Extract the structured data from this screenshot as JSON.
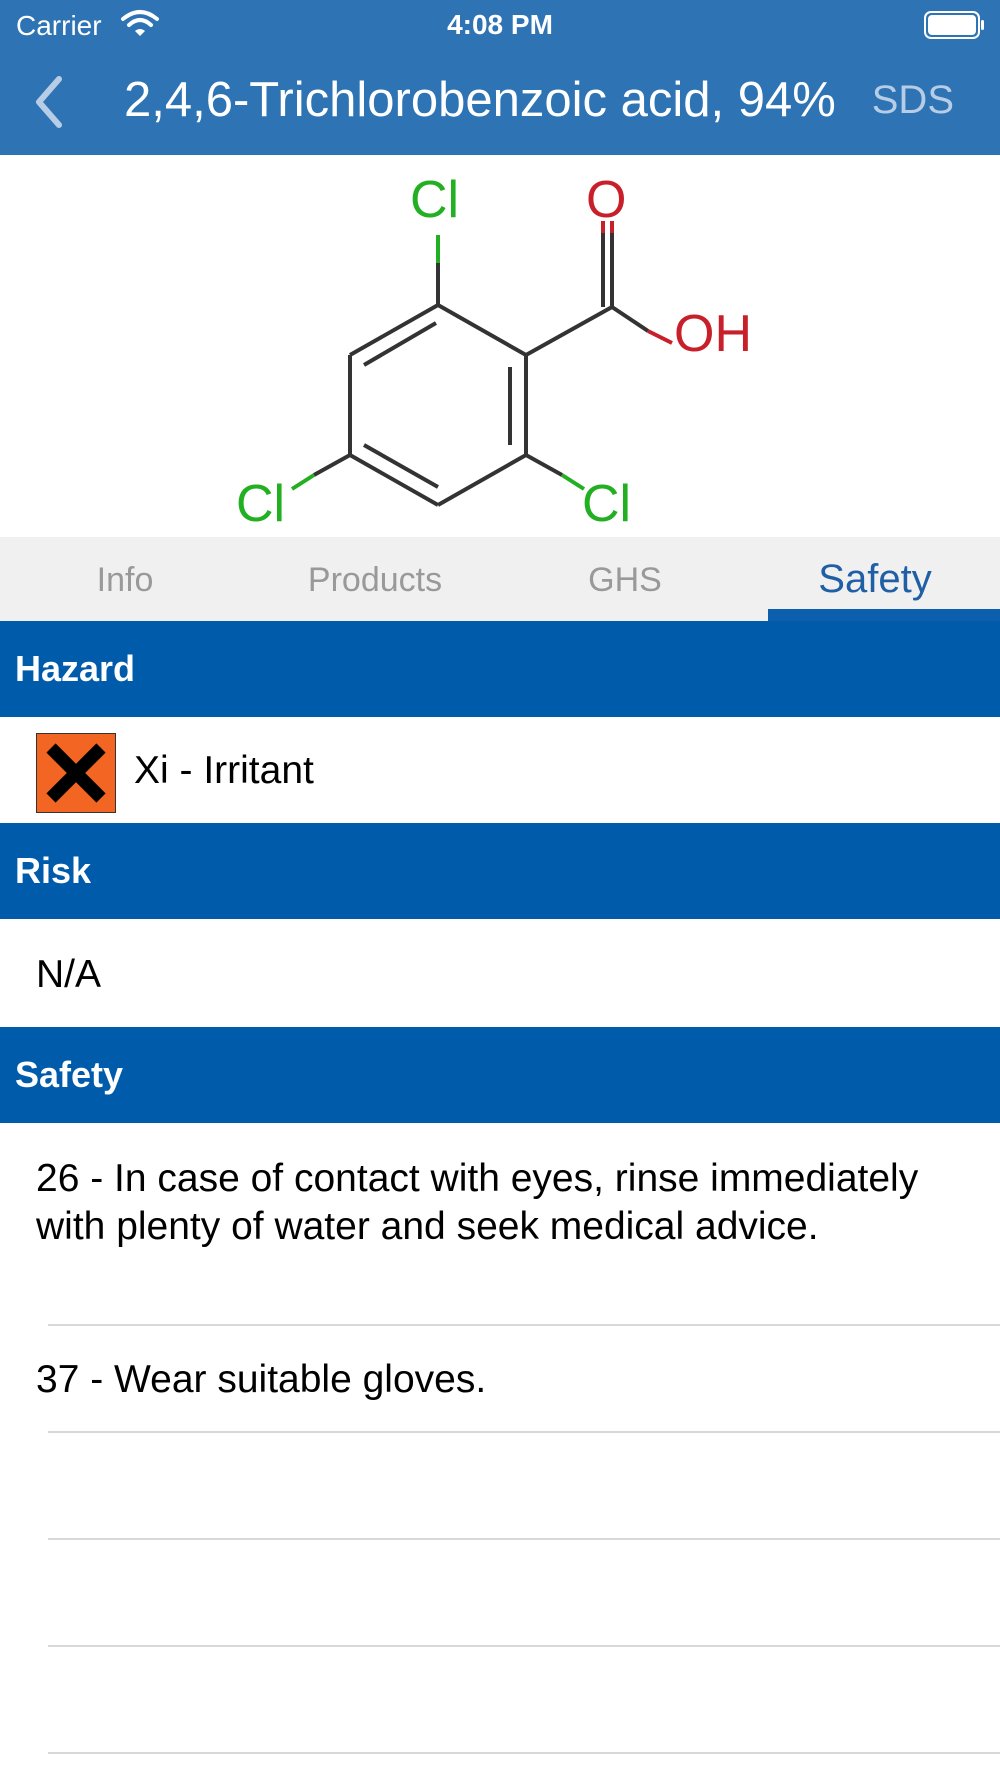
{
  "status_bar": {
    "carrier": "Carrier",
    "time": "4:08 PM"
  },
  "nav": {
    "title": "2,4,6-Trichlorobenzoic acid, 94%",
    "action": "SDS"
  },
  "structure": {
    "atoms": {
      "cl_top": "Cl",
      "o_top": "O",
      "oh": "OH",
      "cl_left": "Cl",
      "cl_right": "Cl"
    },
    "colors": {
      "chlorine": "#22b022",
      "oxygen": "#c8202a",
      "bond": "#333333"
    }
  },
  "tabs": [
    {
      "label": "Info",
      "active": false
    },
    {
      "label": "Products",
      "active": false
    },
    {
      "label": "GHS",
      "active": false
    },
    {
      "label": "Safety",
      "active": true
    }
  ],
  "sections": {
    "hazard": {
      "title": "Hazard",
      "text": "Xi - Irritant",
      "icon": "irritant-x-icon",
      "symbol_color": "#f26522"
    },
    "risk": {
      "title": "Risk",
      "text": "N/A"
    },
    "safety": {
      "title": "Safety",
      "items": [
        "26 - In case of contact with eyes, rinse immediately with plenty of water and seek medical advice.",
        "37 - Wear suitable gloves."
      ]
    }
  },
  "colors": {
    "header": "#2e73b4",
    "section": "#005cab",
    "accent": "#0b5fad"
  }
}
